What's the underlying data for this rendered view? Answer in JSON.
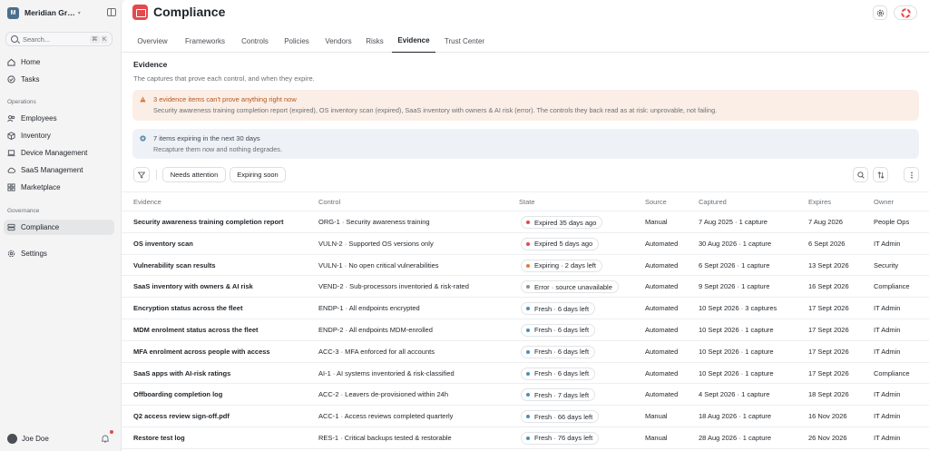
{
  "colors": {
    "accent": "#e5484d",
    "expired": "#e5484d",
    "expiring": "#e07a3d",
    "error": "#8b8f96",
    "fresh": "#4b8fb8"
  },
  "sidebar": {
    "workspace_initial": "M",
    "workspace_name": "Meridian Gr…",
    "search_placeholder": "Search...",
    "search_kbd1": "⌘",
    "search_kbd2": "K",
    "top_items": [
      {
        "label": "Home",
        "icon": "home-icon"
      },
      {
        "label": "Tasks",
        "icon": "check-circle-icon"
      }
    ],
    "operations_label": "Operations",
    "operations_items": [
      {
        "label": "Employees",
        "icon": "people-icon"
      },
      {
        "label": "Inventory",
        "icon": "box-icon"
      },
      {
        "label": "Device Management",
        "icon": "laptop-icon"
      },
      {
        "label": "SaaS Management",
        "icon": "cloud-icon"
      },
      {
        "label": "Marketplace",
        "icon": "grid-icon"
      }
    ],
    "governance_label": "Governance",
    "governance_items": [
      {
        "label": "Compliance",
        "icon": "stack-icon",
        "active": true
      }
    ],
    "settings_label": "Settings",
    "user_name": "Joe Doe"
  },
  "header": {
    "title": "Compliance"
  },
  "tabs": [
    "Overview",
    "Frameworks",
    "Controls",
    "Policies",
    "Vendors",
    "Risks",
    "Evidence",
    "Trust Center"
  ],
  "active_tab": "Evidence",
  "section": {
    "title": "Evidence",
    "subtitle": "The captures that prove each control, and when they expire."
  },
  "alerts": {
    "warning_title": "3 evidence items can't prove anything right now",
    "warning_body": "Security awareness training completion report (expired), OS inventory scan (expired), SaaS inventory with owners & AI risk (error). The controls they back read as at risk: unprovable, not failing.",
    "info_title": "7 items expiring in the next 30 days",
    "info_body": "Recapture them now and nothing degrades."
  },
  "filters": {
    "chip1": "Needs attention",
    "chip2": "Expiring soon"
  },
  "table": {
    "columns": [
      "Evidence",
      "Control",
      "State",
      "Source",
      "Captured",
      "Expires",
      "Owner"
    ],
    "rows": [
      {
        "evidence": "Security awareness training completion report",
        "control": "ORG-1 · Security awareness training",
        "state": "Expired 35 days ago",
        "state_kind": "expired",
        "source": "Manual",
        "captured": "7 Aug 2025 · 1 capture",
        "expires": "7 Aug 2026",
        "owner": "People Ops"
      },
      {
        "evidence": "OS inventory scan",
        "control": "VULN-2 · Supported OS versions only",
        "state": "Expired 5 days ago",
        "state_kind": "expired",
        "source": "Automated",
        "captured": "30 Aug 2026 · 1 capture",
        "expires": "6 Sept 2026",
        "owner": "IT Admin"
      },
      {
        "evidence": "Vulnerability scan results",
        "control": "VULN-1 · No open critical vulnerabilities",
        "state": "Expiring · 2 days left",
        "state_kind": "expiring",
        "source": "Automated",
        "captured": "6 Sept 2026 · 1 capture",
        "expires": "13 Sept 2026",
        "owner": "Security"
      },
      {
        "evidence": "SaaS inventory with owners & AI risk",
        "control": "VEND-2 · Sub-processors inventoried & risk-rated",
        "state": "Error · source unavailable",
        "state_kind": "error",
        "source": "Automated",
        "captured": "9 Sept 2026 · 1 capture",
        "expires": "16 Sept 2026",
        "owner": "Compliance"
      },
      {
        "evidence": "Encryption status across the fleet",
        "control": "ENDP-1 · All endpoints encrypted",
        "state": "Fresh · 6 days left",
        "state_kind": "fresh",
        "source": "Automated",
        "captured": "10 Sept 2026 · 3 captures",
        "expires": "17 Sept 2026",
        "owner": "IT Admin"
      },
      {
        "evidence": "MDM enrolment status across the fleet",
        "control": "ENDP-2 · All endpoints MDM-enrolled",
        "state": "Fresh · 6 days left",
        "state_kind": "fresh",
        "source": "Automated",
        "captured": "10 Sept 2026 · 1 capture",
        "expires": "17 Sept 2026",
        "owner": "IT Admin"
      },
      {
        "evidence": "MFA enrolment across people with access",
        "control": "ACC-3 · MFA enforced for all accounts",
        "state": "Fresh · 6 days left",
        "state_kind": "fresh",
        "source": "Automated",
        "captured": "10 Sept 2026 · 1 capture",
        "expires": "17 Sept 2026",
        "owner": "IT Admin"
      },
      {
        "evidence": "SaaS apps with AI-risk ratings",
        "control": "AI-1 · AI systems inventoried & risk-classified",
        "state": "Fresh · 6 days left",
        "state_kind": "fresh",
        "source": "Automated",
        "captured": "10 Sept 2026 · 1 capture",
        "expires": "17 Sept 2026",
        "owner": "Compliance"
      },
      {
        "evidence": "Offboarding completion log",
        "control": "ACC-2 · Leavers de-provisioned within 24h",
        "state": "Fresh · 7 days left",
        "state_kind": "fresh",
        "source": "Automated",
        "captured": "4 Sept 2026 · 1 capture",
        "expires": "18 Sept 2026",
        "owner": "IT Admin"
      },
      {
        "evidence": "Q2 access review sign-off.pdf",
        "control": "ACC-1 · Access reviews completed quarterly",
        "state": "Fresh · 66 days left",
        "state_kind": "fresh",
        "source": "Manual",
        "captured": "18 Aug 2026 · 1 capture",
        "expires": "16 Nov 2026",
        "owner": "IT Admin"
      },
      {
        "evidence": "Restore test log",
        "control": "RES-1 · Critical backups tested & restorable",
        "state": "Fresh · 76 days left",
        "state_kind": "fresh",
        "source": "Manual",
        "captured": "28 Aug 2026 · 1 capture",
        "expires": "26 Nov 2026",
        "owner": "IT Admin"
      }
    ]
  }
}
